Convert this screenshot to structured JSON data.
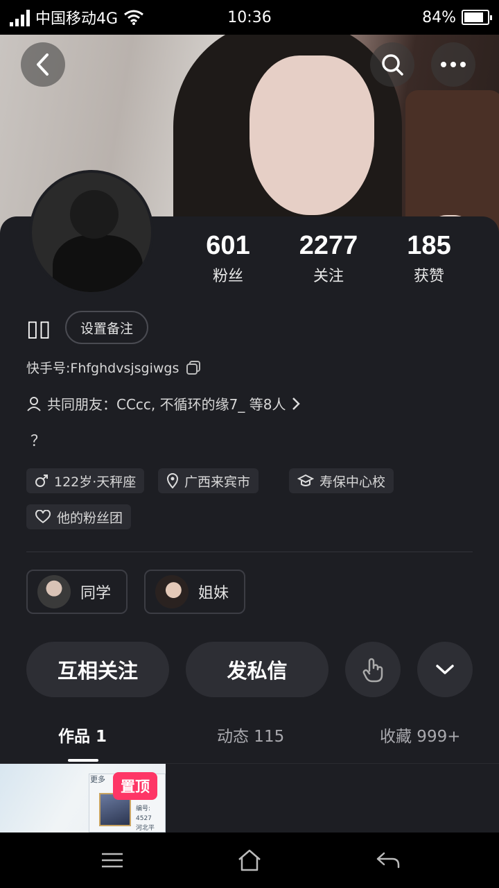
{
  "status_bar": {
    "carrier": "中国移动4G",
    "time": "10:36",
    "battery": "84%",
    "battery_level": 0.84
  },
  "header": {
    "back_icon": "chevron-left-icon",
    "search_icon": "search-icon",
    "more_icon": "more-dots-icon"
  },
  "stats": [
    {
      "value": "601",
      "label": "粉丝"
    },
    {
      "value": "2277",
      "label": "关注"
    },
    {
      "value": "185",
      "label": "获赞"
    }
  ],
  "profile": {
    "name": "▯▯",
    "remark_button": "设置备注",
    "kuaishou_id": "快手号:Fhfghdvsjsgiwgs",
    "mutual_friends": "共同朋友：CCcc, 不循环的缘7_ 等8人",
    "bio": "？"
  },
  "tags": [
    {
      "icon": "male-icon",
      "text": "122岁·天秤座"
    },
    {
      "icon": "location-pin-icon",
      "text": "广西来宾市"
    },
    {
      "icon": "school-icon",
      "text": "寿保中心校"
    },
    {
      "icon": "heart-icon",
      "text": "他的粉丝团"
    }
  ],
  "groups": [
    {
      "label": "同学"
    },
    {
      "label": "姐妹"
    }
  ],
  "actions": {
    "follow_each_other": "互相关注",
    "send_message": "发私信"
  },
  "tabs": [
    {
      "label": "作品 1",
      "active": true
    },
    {
      "label": "动态 115",
      "active": false
    },
    {
      "label": "收藏 999+",
      "active": false
    }
  ],
  "pinned_video": {
    "badge": "置顶",
    "more_text": "更多",
    "meta_line1": "编号: 4527",
    "meta_line2": "河北平"
  },
  "colors": {
    "panel_bg": "#1d1e23",
    "pin_badge": "#fe3666"
  }
}
